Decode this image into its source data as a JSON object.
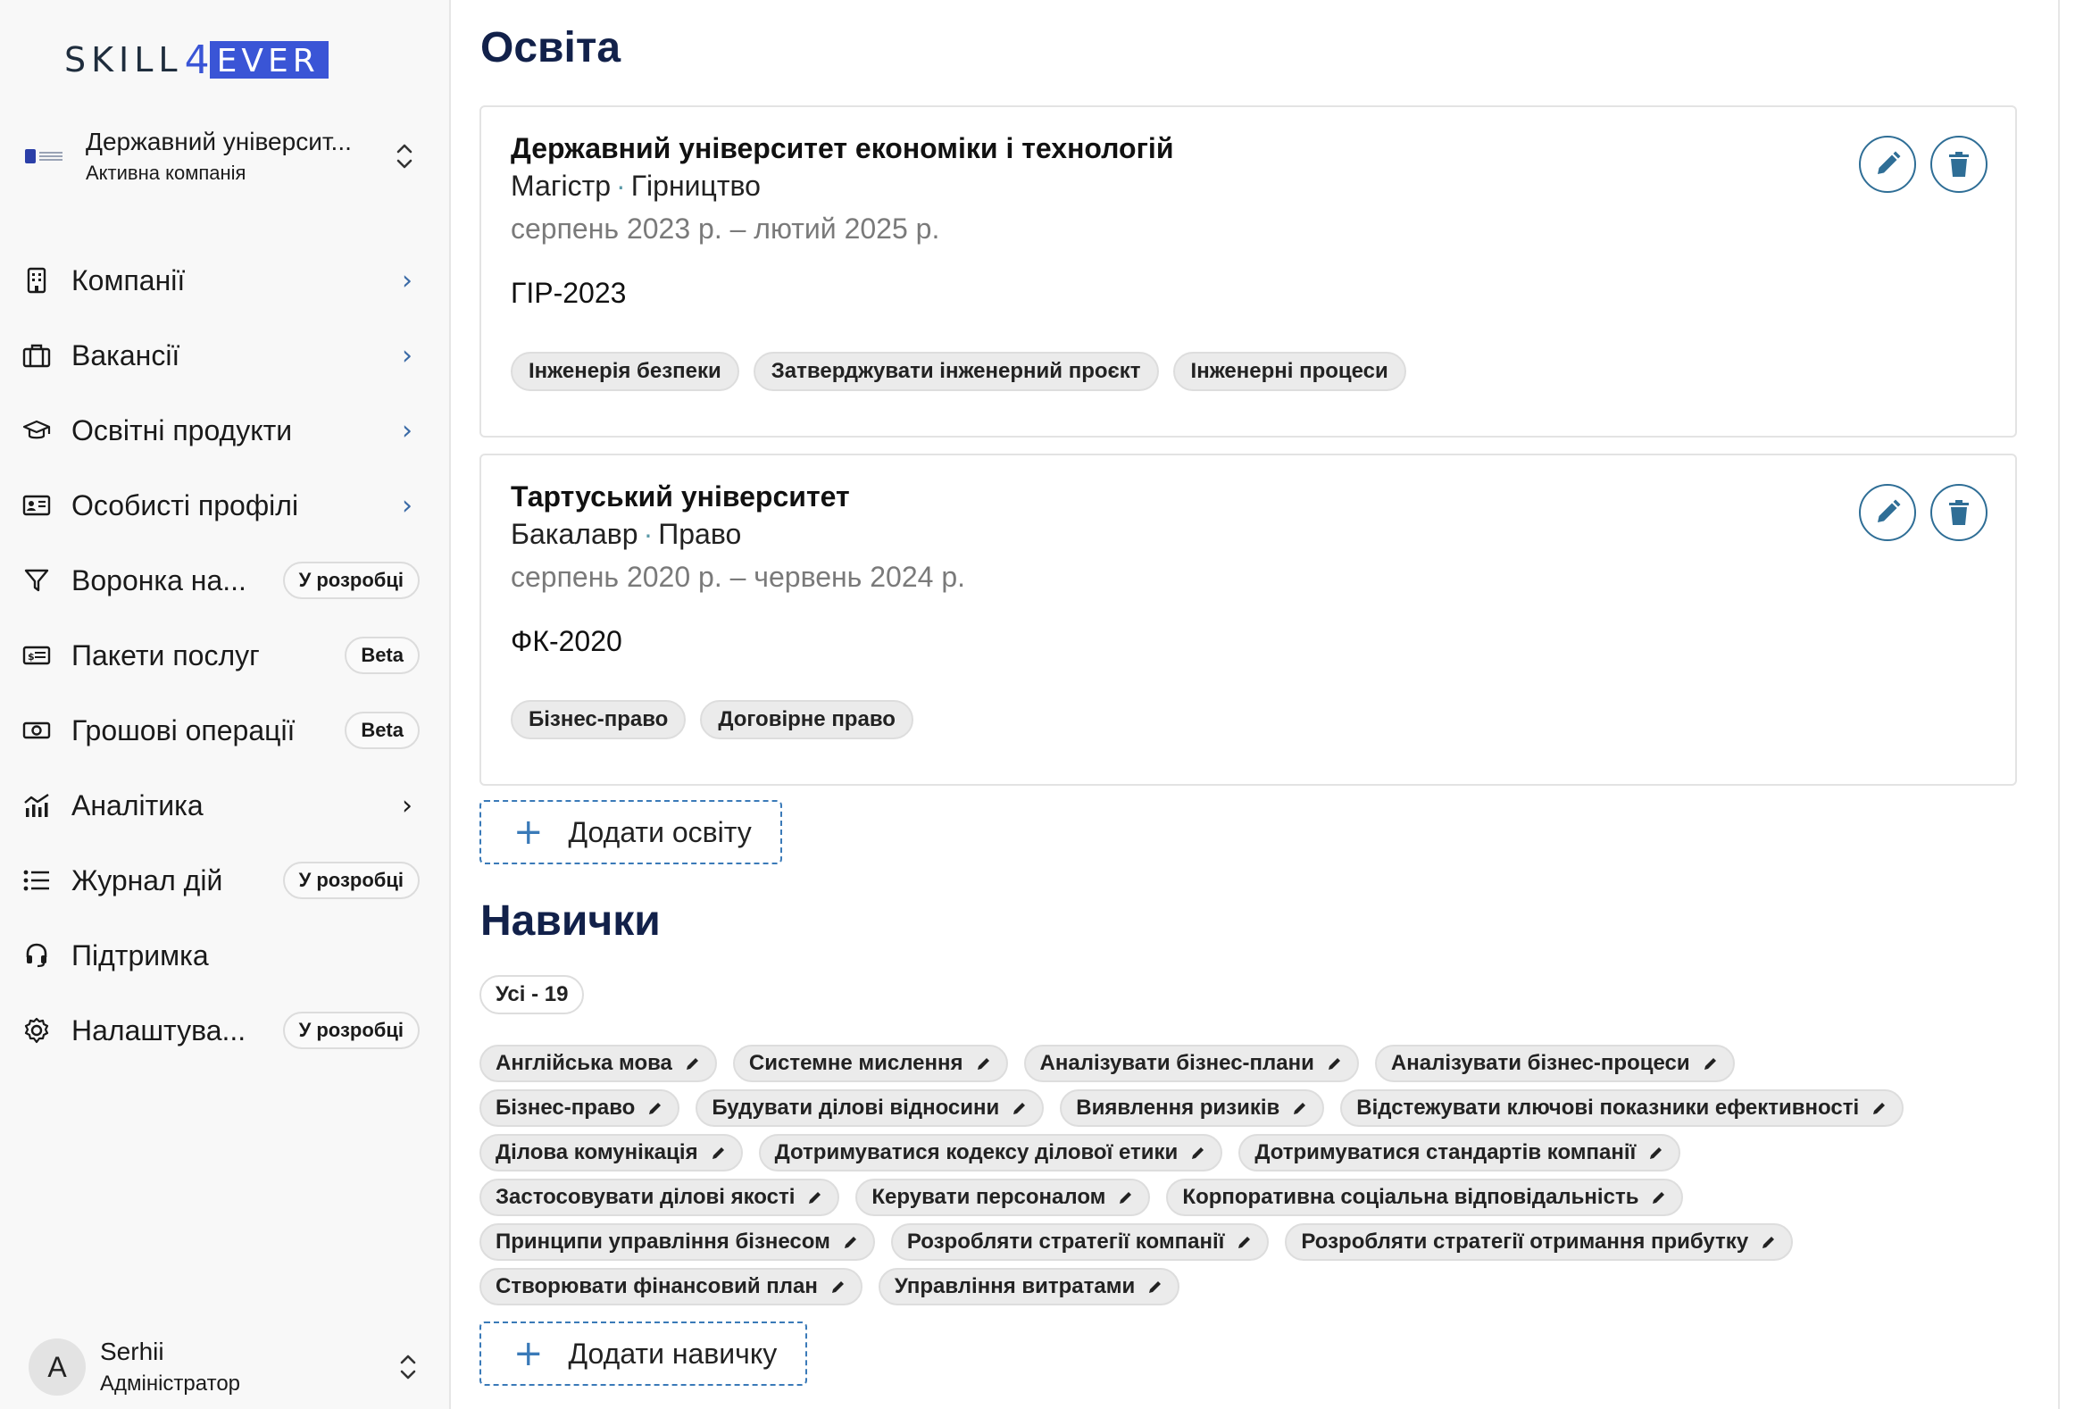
{
  "brand": {
    "logo_left": "SKILL",
    "logo_four": "4",
    "logo_right": "EVER",
    "accent": "#3a55d6"
  },
  "company": {
    "name": "Державний університ...",
    "role": "Активна компанія"
  },
  "nav": [
    {
      "label": "Компанії",
      "icon": "building-icon",
      "chevron": true
    },
    {
      "label": "Вакансії",
      "icon": "briefcase-icon",
      "chevron": true
    },
    {
      "label": "Освітні продукти",
      "icon": "graduation-cap-icon",
      "chevron": true
    },
    {
      "label": "Особисті профілі",
      "icon": "id-card-icon",
      "chevron": true
    },
    {
      "label": "Воронка на...",
      "icon": "filter-icon",
      "badge": "У розробці"
    },
    {
      "label": "Пакети послуг",
      "icon": "package-icon",
      "badge": "Beta"
    },
    {
      "label": "Грошові операції",
      "icon": "money-icon",
      "badge": "Beta"
    },
    {
      "label": "Аналітика",
      "icon": "analytics-icon",
      "chevron": true
    },
    {
      "label": "Журнал дій",
      "icon": "list-icon",
      "badge": "У розробці"
    },
    {
      "label": "Підтримка",
      "icon": "headset-icon"
    },
    {
      "label": "Налаштува...",
      "icon": "gear-icon",
      "badge": "У розробці"
    }
  ],
  "user": {
    "initial": "A",
    "name": "Serhii",
    "role": "Адміністратор"
  },
  "education": {
    "title": "Освіта",
    "items": [
      {
        "institution": "Державний університет економіки і технологій",
        "degree": "Магістр",
        "field": "Гірництво",
        "dates": "серпень 2023 р. – лютий 2025 р.",
        "code": "ГІР-2023",
        "tags": [
          "Інженерія безпеки",
          "Затверджувати інженерний проєкт",
          "Інженерні процеси"
        ]
      },
      {
        "institution": "Тартуський університет",
        "degree": "Бакалавр",
        "field": "Право",
        "dates": "серпень 2020 р. – червень 2024 р.",
        "code": "ФК-2020",
        "tags": [
          "Бізнес-право",
          "Договірне право"
        ]
      }
    ],
    "add_label": "Додати освіту"
  },
  "skills": {
    "title": "Навички",
    "filter_label": "Усі - 19",
    "rows": [
      [
        "Англійська мова",
        "Системне мислення",
        "Аналізувати бізнес-плани",
        "Аналізувати бізнес-процеси"
      ],
      [
        "Бізнес-право",
        "Будувати ділові відносини",
        "Виявлення ризиків",
        "Відстежувати ключові показники ефективності"
      ],
      [
        "Ділова комунікація",
        "Дотримуватися кодексу ділової етики",
        "Дотримуватися стандартів компанії"
      ],
      [
        "Застосовувати ділові якості",
        "Керувати персоналом",
        "Корпоративна соціальна відповідальність"
      ],
      [
        "Принципи управління бізнесом",
        "Розробляти стратегії компанії",
        "Розробляти стратегії отримання прибутку"
      ],
      [
        "Створювати фінансовий план",
        "Управління витратами"
      ]
    ],
    "add_label": "Додати навичку"
  }
}
